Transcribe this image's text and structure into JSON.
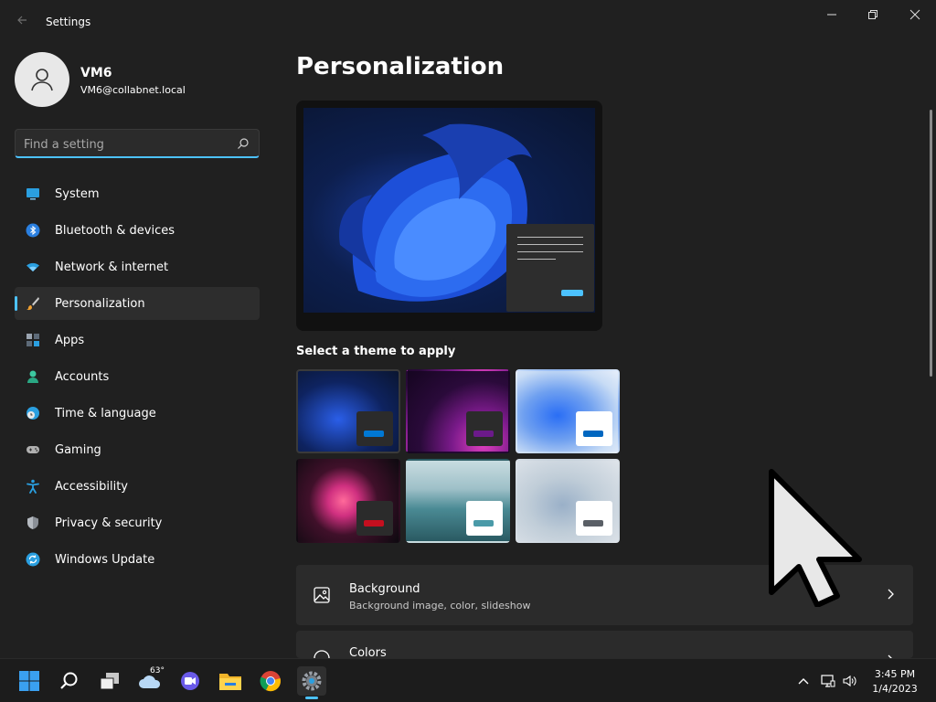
{
  "window": {
    "title": "Settings"
  },
  "profile": {
    "name": "VM6",
    "email": "VM6@collabnet.local"
  },
  "search": {
    "placeholder": "Find a setting",
    "value": ""
  },
  "sidebar": {
    "items": [
      {
        "label": "System",
        "icon": "monitor-icon",
        "active": false
      },
      {
        "label": "Bluetooth & devices",
        "icon": "bluetooth-icon",
        "active": false
      },
      {
        "label": "Network & internet",
        "icon": "wifi-icon",
        "active": false
      },
      {
        "label": "Personalization",
        "icon": "brush-icon",
        "active": true
      },
      {
        "label": "Apps",
        "icon": "apps-icon",
        "active": false
      },
      {
        "label": "Accounts",
        "icon": "person-icon",
        "active": false
      },
      {
        "label": "Time & language",
        "icon": "clock-globe-icon",
        "active": false
      },
      {
        "label": "Gaming",
        "icon": "gamepad-icon",
        "active": false
      },
      {
        "label": "Accessibility",
        "icon": "accessibility-icon",
        "active": false
      },
      {
        "label": "Privacy & security",
        "icon": "shield-icon",
        "active": false
      },
      {
        "label": "Windows Update",
        "icon": "update-icon",
        "active": false
      }
    ]
  },
  "main": {
    "title": "Personalization",
    "theme_section_label": "Select a theme to apply",
    "themes": [
      {
        "name": "windows-dark-bloom",
        "accent": "#0078d4",
        "window": "#2b2b2b",
        "selected": true
      },
      {
        "name": "glow",
        "accent": "#6b1a8a",
        "window": "#2b2b2b",
        "selected": false
      },
      {
        "name": "windows-light-bloom",
        "accent": "#0067c0",
        "window": "#ffffff",
        "selected": false
      },
      {
        "name": "captured-motion",
        "accent": "#c50f1f",
        "window": "#2b2b2b",
        "selected": false
      },
      {
        "name": "sunrise-lake",
        "accent": "#4a9aa8",
        "window": "#ffffff",
        "selected": false
      },
      {
        "name": "flow",
        "accent": "#5a5f66",
        "window": "#ffffff",
        "selected": false
      }
    ],
    "cards": [
      {
        "title": "Background",
        "description": "Background image, color, slideshow",
        "icon": "image-icon"
      },
      {
        "title": "Colors",
        "description": "",
        "icon": "palette-icon"
      }
    ]
  },
  "taskbar": {
    "weather_temp": "63°",
    "time": "3:45 PM",
    "date": "1/4/2023"
  },
  "colors": {
    "accent": "#4cc2ff",
    "background": "#202020",
    "card": "#2b2b2b"
  }
}
